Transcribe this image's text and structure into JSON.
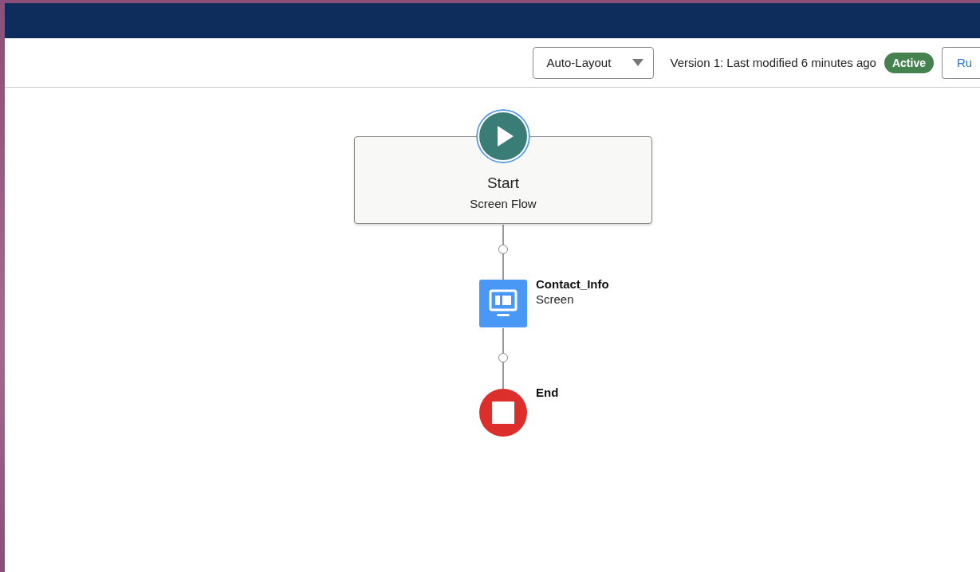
{
  "toolbar": {
    "layout_select": {
      "value": "Auto-Layout"
    },
    "version_text": "Version 1: Last modified 6 minutes ago",
    "status_badge": "Active",
    "run_button": "Ru"
  },
  "flow": {
    "nodes": [
      {
        "kind": "start",
        "title": "Start",
        "subtitle": "Screen Flow"
      },
      {
        "kind": "screen",
        "title": "Contact_Info",
        "subtitle": "Screen"
      },
      {
        "kind": "end",
        "title": "End"
      }
    ]
  }
}
